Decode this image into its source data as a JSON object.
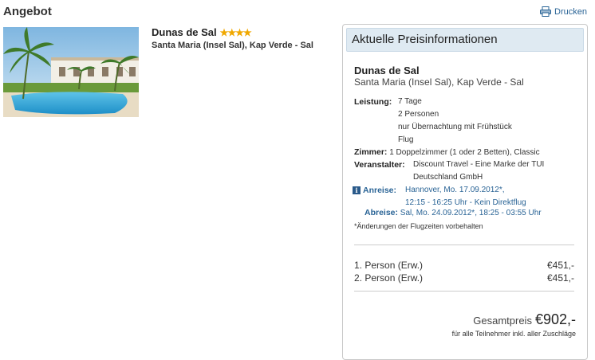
{
  "page": {
    "title": "Angebot",
    "print_label": "Drucken"
  },
  "hotel": {
    "name": "Dunas de Sal",
    "stars": "★★★★",
    "location": "Santa Maria (Insel Sal), Kap Verde - Sal"
  },
  "panel": {
    "heading": "Aktuelle Preisinformationen",
    "hotel_name": "Dunas de Sal",
    "location": "Santa Maria (Insel Sal), Kap Verde - Sal",
    "leistung_label": "Leistung:",
    "leistung": [
      "7 Tage",
      "2 Personen",
      "nur Übernachtung mit Frühstück",
      "Flug"
    ],
    "zimmer_label": "Zimmer:",
    "zimmer": "1 Doppelzimmer (1 oder 2 Betten), Classic",
    "veranstalter_label": "Veranstalter:",
    "veranstalter": [
      "Discount Travel - Eine Marke der TUI",
      "Deutschland GmbH"
    ],
    "anreise_label": "Anreise:",
    "anreise": [
      "Hannover, Mo. 17.09.2012*,",
      "12:15 - 16:25 Uhr - Kein Direktflug"
    ],
    "abreise_label": "Abreise:",
    "abreise": "Sal, Mo. 24.09.2012*, 18:25 - 03:55 Uhr",
    "note": "*Änderungen der Flugzeiten vorbehalten",
    "persons": [
      {
        "label": "1. Person (Erw.)",
        "price": "€451,-"
      },
      {
        "label": "2. Person (Erw.)",
        "price": "€451,-"
      }
    ],
    "total_label": "Gesamtpreis",
    "total_value": "€902,-",
    "total_note": "für alle Teilnehmer inkl. aller Zuschläge"
  },
  "colors": {
    "link": "#2a6496",
    "header_bg": "#dfeaf2",
    "star": "#f0a800"
  }
}
